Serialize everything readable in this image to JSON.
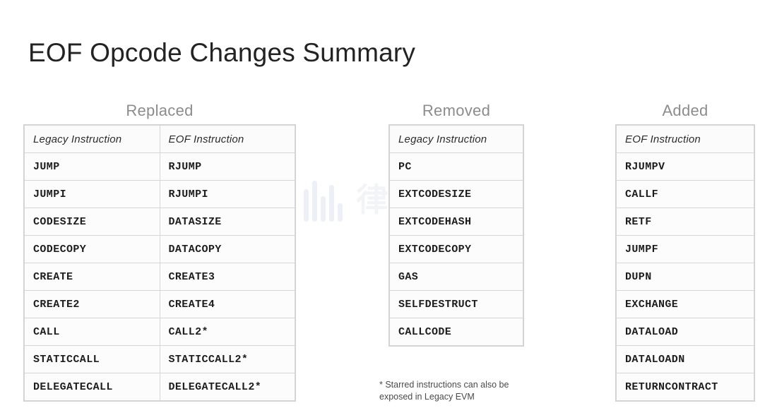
{
  "title": "EOF Opcode Changes Summary",
  "watermark": {
    "text": "律动",
    "icon": "bar-logo-icon"
  },
  "columns": {
    "replaced": {
      "heading": "Replaced",
      "headers": [
        "Legacy Instruction",
        "EOF Instruction"
      ],
      "rows": [
        [
          "JUMP",
          "RJUMP"
        ],
        [
          "JUMPI",
          "RJUMPI"
        ],
        [
          "CODESIZE",
          "DATASIZE"
        ],
        [
          "CODECOPY",
          "DATACOPY"
        ],
        [
          "CREATE",
          "CREATE3"
        ],
        [
          "CREATE2",
          "CREATE4"
        ],
        [
          "CALL",
          "CALL2*"
        ],
        [
          "STATICCALL",
          "STATICCALL2*"
        ],
        [
          "DELEGATECALL",
          "DELEGATECALL2*"
        ]
      ]
    },
    "removed": {
      "heading": "Removed",
      "headers": [
        "Legacy Instruction"
      ],
      "rows": [
        [
          "PC"
        ],
        [
          "EXTCODESIZE"
        ],
        [
          "EXTCODEHASH"
        ],
        [
          "EXTCODECOPY"
        ],
        [
          "GAS"
        ],
        [
          "SELFDESTRUCT"
        ],
        [
          "CALLCODE"
        ]
      ]
    },
    "added": {
      "heading": "Added",
      "headers": [
        "EOF Instruction"
      ],
      "rows": [
        [
          "RJUMPV"
        ],
        [
          "CALLF"
        ],
        [
          "RETF"
        ],
        [
          "JUMPF"
        ],
        [
          "DUPN"
        ],
        [
          "EXCHANGE"
        ],
        [
          "DATALOAD"
        ],
        [
          "DATALOADN"
        ],
        [
          "RETURNCONTRACT"
        ]
      ]
    }
  },
  "footnote": "* Starred instructions can also be exposed in Legacy EVM",
  "colors": {
    "background": "#ffffff",
    "title": "#232323",
    "heading": "#8c8c8c",
    "border": "#d6d6d6",
    "cell_text": "#1d1d1d"
  }
}
